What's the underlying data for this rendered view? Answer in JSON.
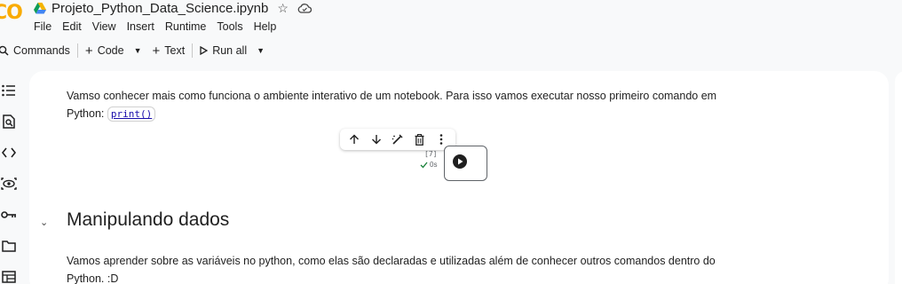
{
  "app": {
    "logo_text": "CO"
  },
  "notebook": {
    "title": "Projeto_Python_Data_Science.ipynb"
  },
  "menu": [
    "File",
    "Edit",
    "View",
    "Insert",
    "Runtime",
    "Tools",
    "Help"
  ],
  "toolbar": {
    "commands_label": "Commands",
    "code_label": "Code",
    "text_label": "Text",
    "run_all_label": "Run all"
  },
  "rail_icons": [
    "table-of-contents-icon",
    "find-replace-icon",
    "code-snippets-icon",
    "variables-icon",
    "secrets-key-icon",
    "folder-icon",
    "terminal-icon"
  ],
  "cells": {
    "intro_text": "Vamso conhecer mais como funciona o ambiente interativo de um notebook. Para isso vamos executar nosso primeiro comando em",
    "intro_text_prefix": "Python: ",
    "intro_code": "print()",
    "exec_count": "[7]",
    "exec_time": "0s",
    "section_heading": "Manipulando dados",
    "section_text": "Vamos aprender sobre as variáveis no python, como elas são declaradas e utilizadas além de conhecer outros comandos dentro do",
    "section_text_line2": "Python. :D"
  },
  "colors": {
    "logo": "#f9ab00",
    "link": "#1a0dab",
    "success": "#188038",
    "drive_blue": "#4285f4",
    "drive_green": "#0f9d58",
    "drive_yellow": "#f4b400"
  }
}
